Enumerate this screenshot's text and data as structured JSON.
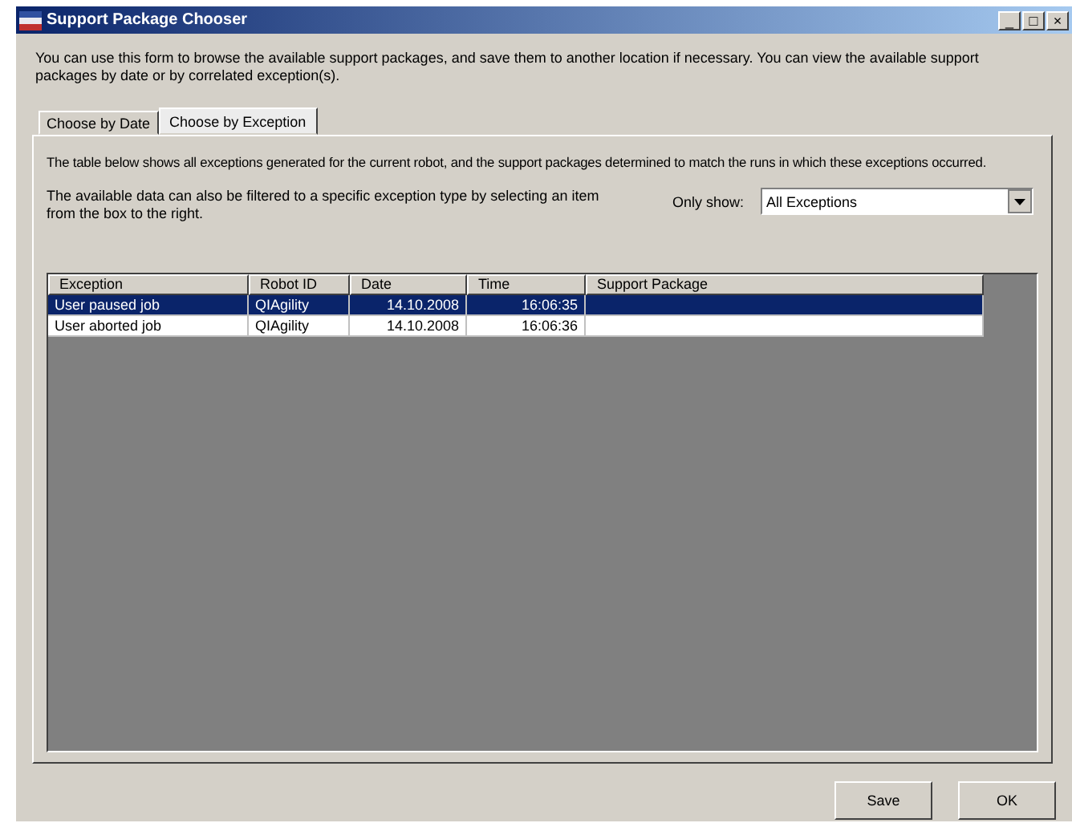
{
  "window": {
    "title": "Support Package Chooser",
    "controls": [
      "_",
      "□",
      "×"
    ]
  },
  "description": "You can use this form to browse the available support packages, and save them to another location if necessary. You can view the available support packages by date or by correlated exception(s).",
  "tabs": [
    {
      "label": "Choose by Date",
      "selected": false
    },
    {
      "label": "Choose by Exception",
      "selected": true
    }
  ],
  "panel": {
    "intro": "The table below shows all exceptions generated for the current robot, and the support packages determined to match the runs in which these exceptions occurred.",
    "filter_hint": "The available data can also be filtered to a specific exception type by selecting an item from the box to the right.",
    "filter_label": "Only show:",
    "filter": {
      "value": "All Exceptions"
    }
  },
  "table": {
    "columns": [
      "Exception",
      "Robot ID",
      "Date",
      "Time",
      "Support Package"
    ],
    "rows": [
      {
        "cells": [
          "User paused job",
          "QIAgility",
          "14.10.2008",
          "16:06:35",
          ""
        ],
        "selected": true
      },
      {
        "cells": [
          "User aborted job",
          "QIAgility",
          "14.10.2008",
          "16:06:36",
          ""
        ],
        "selected": false
      }
    ]
  },
  "buttons": [
    "Save",
    "OK"
  ]
}
